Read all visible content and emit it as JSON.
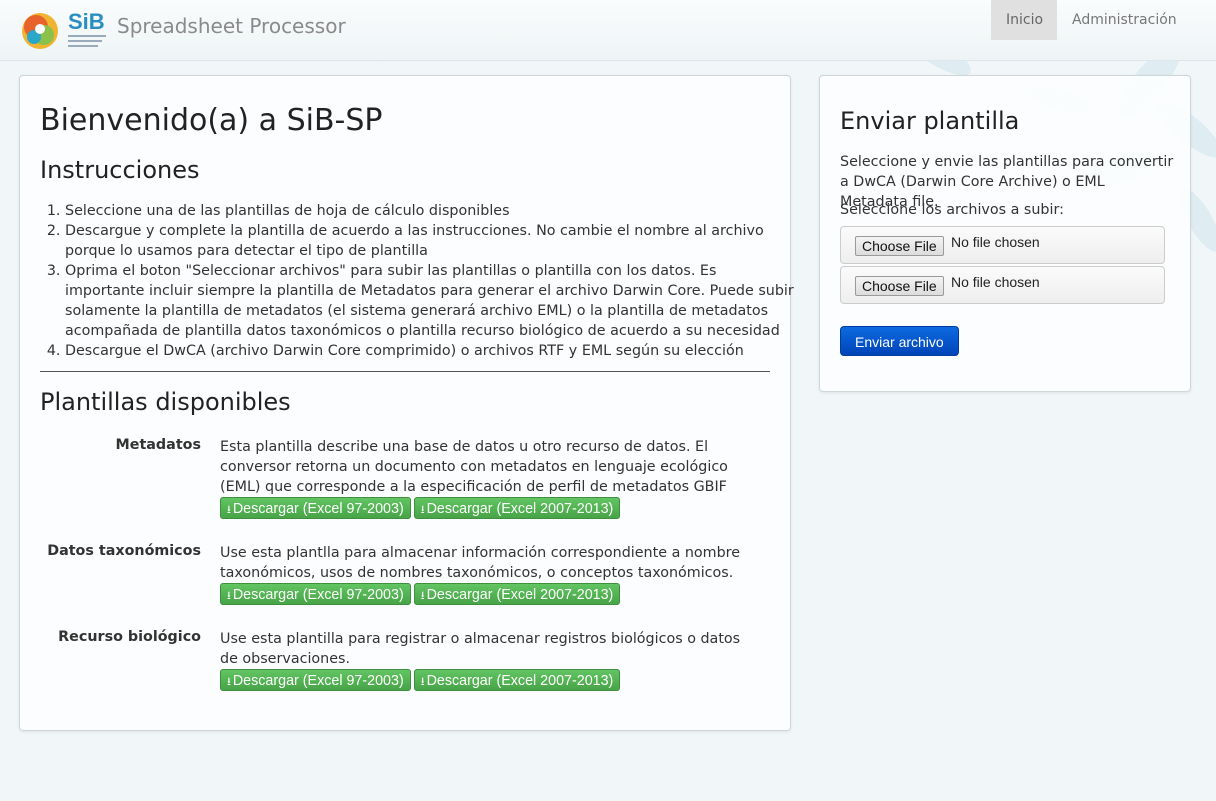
{
  "header": {
    "logo_text": "SiB",
    "brand": "Spreadsheet Processor",
    "nav": [
      {
        "label": "Inicio",
        "active": true
      },
      {
        "label": "Administración",
        "active": false
      }
    ]
  },
  "main": {
    "title": "Bienvenido(a) a SiB-SP",
    "instructions_heading": "Instrucciones",
    "instructions": [
      "Seleccione una de las plantillas de hoja de cálculo disponibles",
      "Descargue y complete la plantilla de acuerdo a las instrucciones. No cambie el nombre al archivo porque lo usamos para detectar el tipo de plantilla",
      "Oprima el boton \"Seleccionar archivos\" para subir las plantillas o plantilla con los datos. Es importante incluir siempre la plantilla de Metadatos para generar el archivo Darwin Core. Puede subir solamente la plantilla de metadatos (el sistema generará archivo EML) o la plantilla de metadatos acompañada de plantilla datos taxonómicos o plantilla recurso biológico de acuerdo a su necesidad",
      "Descargue el DwCA (archivo Darwin Core comprimido) o archivos RTF y EML según su elección"
    ],
    "templates_heading": "Plantillas disponibles",
    "templates": [
      {
        "name": "Metadatos",
        "description": "Esta plantilla describe una base de datos u otro recurso de datos. El conversor retorna un documento con metadatos en lenguaje ecológico (EML) que corresponde a la especificación de perfil de metadatos GBIF (GMP)",
        "btn_old": "Descargar (Excel 97-2003)",
        "btn_new": "Descargar (Excel 2007-2013)"
      },
      {
        "name": "Datos taxonómicos",
        "description": "Use esta plantlla para almacenar información correspondiente a nombre taxonómicos, usos de nombres taxonómicos, o conceptos taxonómicos.",
        "btn_old": "Descargar (Excel 97-2003)",
        "btn_new": "Descargar (Excel 2007-2013)"
      },
      {
        "name": "Recurso biológico",
        "description": "Use esta plantilla para registrar o almacenar registros biológicos o datos de observaciones.",
        "btn_old": "Descargar (Excel 97-2003)",
        "btn_new": "Descargar (Excel 2007-2013)"
      }
    ]
  },
  "upload": {
    "title": "Enviar plantilla",
    "description": "Seleccione y envie las plantillas para convertir a DwCA (Darwin Core Archive) o EML Metadata file.",
    "files_label": "Seleccione los archivos a subir:",
    "file_inputs": [
      {
        "button": "Choose File",
        "status": "No file chosen"
      },
      {
        "button": "Choose File",
        "status": "No file chosen"
      }
    ],
    "submit": "Enviar archivo"
  },
  "colors": {
    "download_green": "#5cb85c",
    "submit_blue": "#0055cc",
    "nav_active_bg": "#e0e0e0"
  },
  "icons": [
    "download-icon"
  ]
}
